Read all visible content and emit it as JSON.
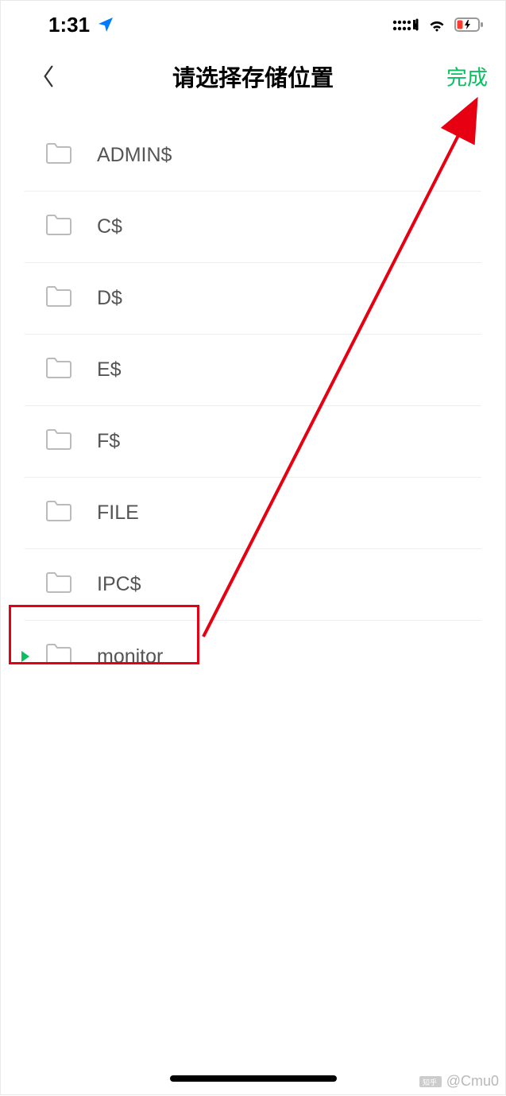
{
  "statusbar": {
    "time": "1:31",
    "location_icon": "location-arrow-icon",
    "signal_icon": "dual-sim-signal-icon",
    "wifi_icon": "wifi-icon",
    "battery_icon": "battery-charging-low-icon"
  },
  "navbar": {
    "back_icon": "chevron-left-icon",
    "title": "请选择存储位置",
    "done_label": "完成"
  },
  "list": {
    "items": [
      {
        "label": "ADMIN$",
        "selected": false
      },
      {
        "label": "C$",
        "selected": false
      },
      {
        "label": "D$",
        "selected": false
      },
      {
        "label": "E$",
        "selected": false
      },
      {
        "label": "F$",
        "selected": false
      },
      {
        "label": "FILE",
        "selected": false
      },
      {
        "label": "IPC$",
        "selected": false
      },
      {
        "label": "monitor",
        "selected": true
      }
    ]
  },
  "annotations": {
    "highlight_box_target": "row-monitor",
    "arrow_from": "row-monitor",
    "arrow_to": "done-button",
    "arrow_color": "#e60012",
    "box_color": "#e60012"
  },
  "watermark": {
    "logo": "zhihu-logo-icon",
    "text": "@Cmu0"
  }
}
